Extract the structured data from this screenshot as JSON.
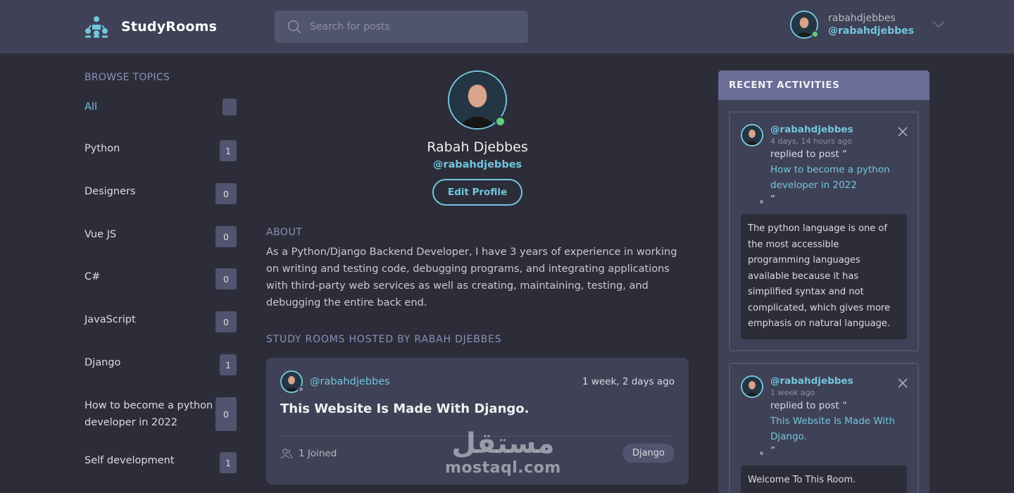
{
  "header": {
    "brand": "StudyRooms",
    "search_placeholder": "Search for posts",
    "user": {
      "name": "rabahdjebbes",
      "handle": "@rabahdjebbes"
    }
  },
  "sidebar": {
    "title": "BROWSE TOPICS",
    "topics": [
      {
        "label": "All",
        "count": ""
      },
      {
        "label": "Python",
        "count": "1"
      },
      {
        "label": "Designers",
        "count": "0"
      },
      {
        "label": "Vue JS",
        "count": "0"
      },
      {
        "label": "C#",
        "count": "0"
      },
      {
        "label": "JavaScript",
        "count": "0"
      },
      {
        "label": "Django",
        "count": "1"
      },
      {
        "label": "How to become a python developer in 2022",
        "count": "0"
      },
      {
        "label": "Self development",
        "count": "1"
      }
    ]
  },
  "profile": {
    "name": "Rabah Djebbes",
    "handle": "@rabahdjebbes",
    "edit_label": "Edit Profile",
    "about_title": "ABOUT",
    "about_text": "As a Python/Django Backend Developer, I have 3 years of experience in working on writing and testing code, debugging programs, and integrating applications with third-party web services as well as creating, maintaining, testing, and debugging the entire back end.",
    "hosted_title": "STUDY ROOMS HOSTED BY RABAH DJEBBES"
  },
  "room": {
    "host": "@rabahdjebbes",
    "time": "1 week, 2 days ago",
    "title": "This Website Is Made With Django.",
    "joined": "1 Joined",
    "tag": "Django"
  },
  "activities": {
    "title": "RECENT ACTIVITIES",
    "items": [
      {
        "handle": "@rabahdjebbes",
        "time": "4 days, 14 hours ago",
        "replied": "replied to post “",
        "link": "How to become a python developer in 2022",
        "quote_end": "”",
        "body": "The python language is one of the most accessible programming languages available because it has simplified syntax and not complicated, which gives more emphasis on natural language."
      },
      {
        "handle": "@rabahdjebbes",
        "time": "1 week ago",
        "replied": "replied to post “",
        "link": "This Website Is Made With Django.",
        "quote_end": "”",
        "body": "Welcome To This Room."
      }
    ]
  },
  "watermark": {
    "arabic": "مستقل",
    "latin": "mostaql.com"
  },
  "colors": {
    "accent": "#71c6dd",
    "bg": "#2d2d39",
    "card": "#3f4156",
    "muted": "#8c8fb8",
    "online": "#5cd181"
  }
}
